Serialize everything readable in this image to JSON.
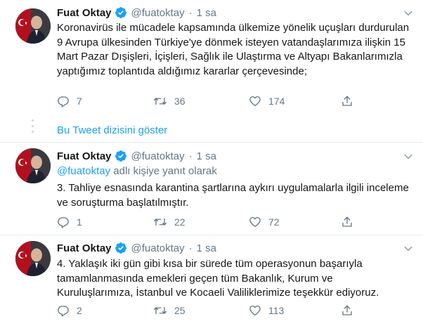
{
  "author": {
    "name": "Fuat Oktay",
    "handle": "@fuatoktay"
  },
  "thread_link": "Bu Tweet dizisini göster",
  "tweets": [
    {
      "time": "1 sa",
      "text": "Koronavirüs ile mücadele kapsamında ülkemize yönelik uçuşları durdurulan 9 Avrupa ülkesinden Türkiye'ye dönmek isteyen vatandaşlarımıza ilişkin 15 Mart Pazar Dışişleri, İçişleri, Sağlık ile Ulaştırma ve Altyapı Bakanlarımızla yaptığımız toplantıda aldığımız kararlar çerçevesinde;",
      "replies": "7",
      "retweets": "36",
      "likes": "174"
    },
    {
      "time": "1 sa",
      "reply_to_mention": "@fuatoktay",
      "reply_to_suffix": "adlı kişiye yanıt olarak",
      "text": "3. Tahliye esnasında karantina şartlarına aykırı uygulamalarla ilgili inceleme ve soruşturma başlatılmıştır.",
      "replies": "1",
      "retweets": "22",
      "likes": "72"
    },
    {
      "time": "1 sa",
      "text": "4. Yaklaşık iki gün gibi kısa bir sürede tüm operasyonun başarıyla tamamlanmasında emekleri geçen tüm Bakanlık, Kurum ve Kuruluşlarımıza, İstanbul ve Kocaeli Valiliklerimize teşekkür ediyoruz.",
      "replies": "2",
      "retweets": "25",
      "likes": "113"
    }
  ],
  "colors": {
    "link": "#1da1f2",
    "muted": "#657786",
    "text": "#14171a",
    "divider": "#e6ecf0",
    "verified": "#1da1f2"
  },
  "icons": [
    "verified-badge-icon",
    "chevron-down-icon",
    "reply-icon",
    "retweet-icon",
    "like-icon",
    "share-icon"
  ]
}
